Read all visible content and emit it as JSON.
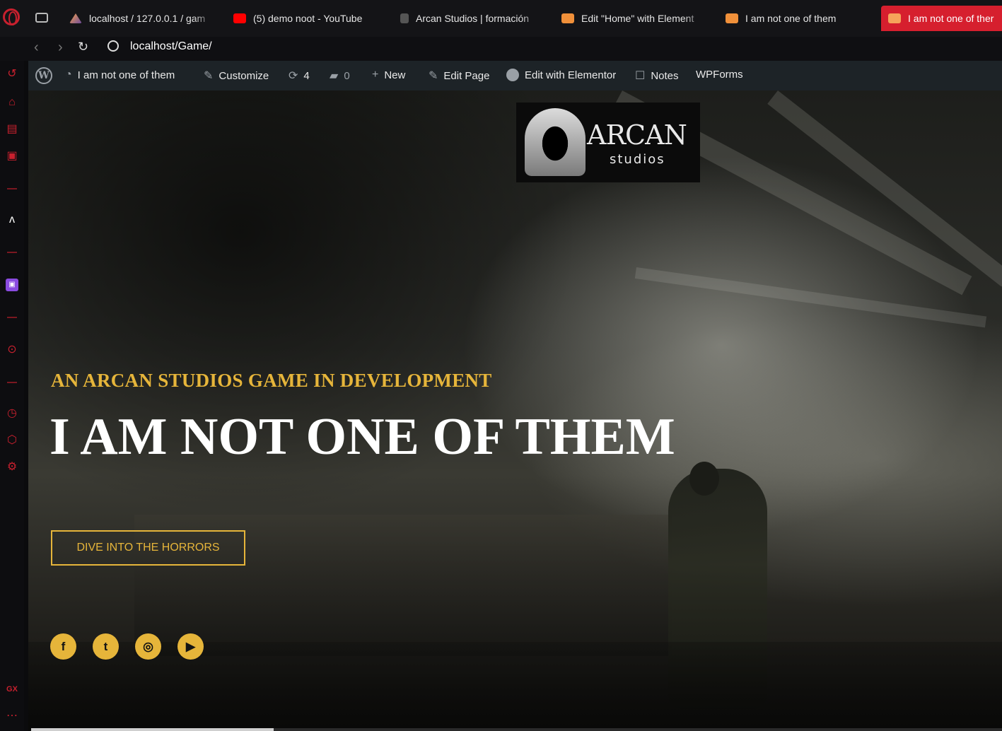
{
  "browser": {
    "tabs": [
      {
        "label": "localhost / 127.0.0.1 / gam",
        "icon": "phpmyadmin-icon"
      },
      {
        "label": "(5) demo noot - YouTube",
        "icon": "youtube-icon"
      },
      {
        "label": "Arcan Studios | formación",
        "icon": "hood-icon"
      },
      {
        "label": "Edit \"Home\" with Element",
        "icon": "elementor-icon"
      },
      {
        "label": "I am not one of them",
        "icon": "elementor-icon"
      },
      {
        "label": "I am not one of ther",
        "icon": "elementor-icon"
      }
    ],
    "active_tab_index": 5,
    "url": "localhost/Game/",
    "accent_color": "#d61f2e"
  },
  "wp_admin_bar": {
    "site_name": "I am not one of them",
    "customize": "Customize",
    "updates_count": "4",
    "comments_count": "0",
    "new": "New",
    "edit_page": "Edit Page",
    "edit_elementor": "Edit with Elementor",
    "notes": "Notes",
    "wpforms": "WPForms"
  },
  "hero": {
    "logo_title": "ARCAN",
    "logo_subtitle": "studios",
    "eyebrow": "AN ARCAN STUDIOS GAME IN DEVELOPMENT",
    "headline": "I AM NOT ONE OF THEM",
    "cta_label": "DIVE INTO THE HORRORS",
    "accent_color": "#e6b53a",
    "social": [
      {
        "name": "facebook-icon",
        "glyph": "f"
      },
      {
        "name": "twitter-icon",
        "glyph": "t"
      },
      {
        "name": "instagram-icon",
        "glyph": "◎"
      },
      {
        "name": "youtube-icon",
        "glyph": "▶"
      }
    ]
  },
  "page_progress": 0.25
}
